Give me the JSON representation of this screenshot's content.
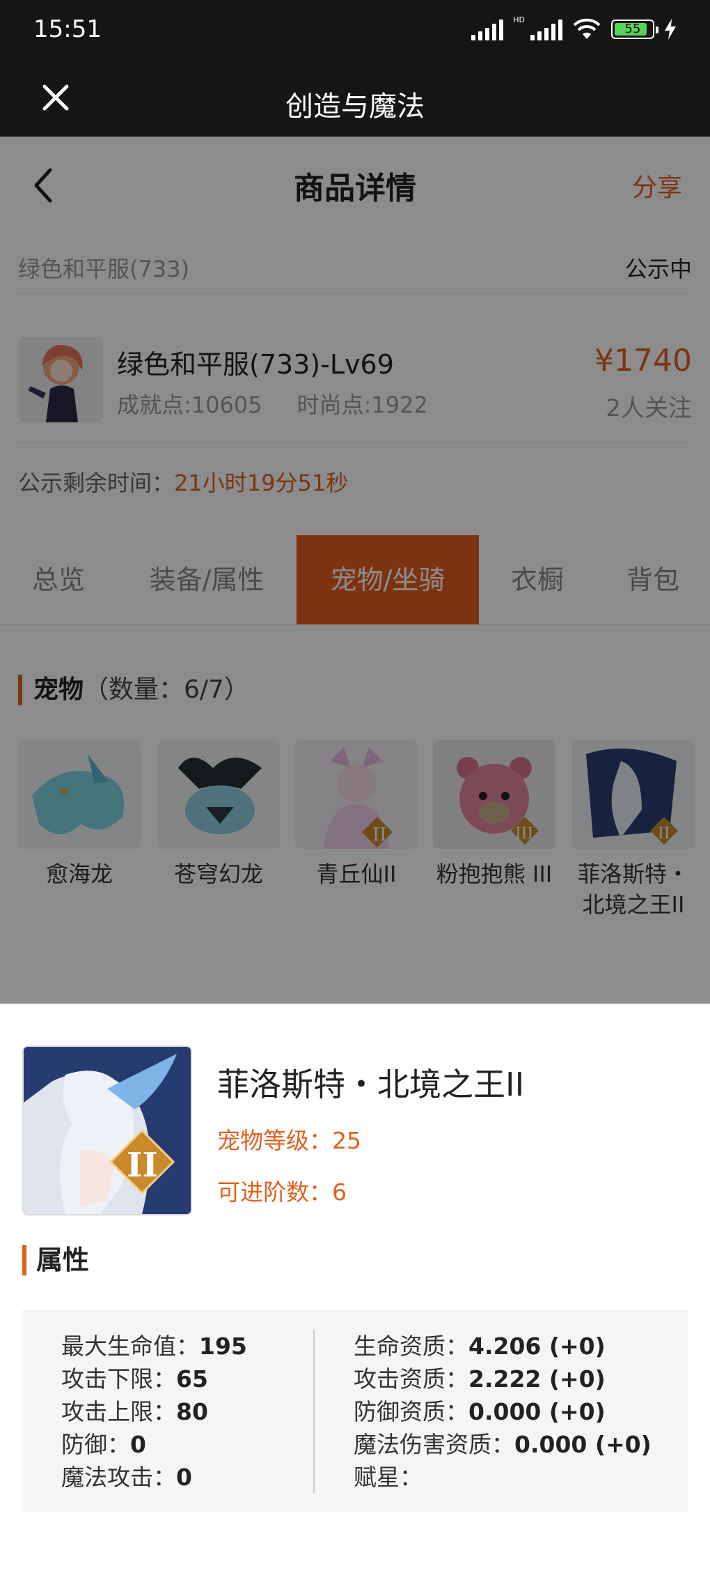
{
  "status": {
    "time": "15:51",
    "hd": "HD",
    "battery": "55"
  },
  "app": {
    "title": "创造与魔法"
  },
  "nav": {
    "title": "商品详情",
    "share": "分享"
  },
  "listing": {
    "name": "绿色和平服(733)",
    "status": "公示中"
  },
  "product": {
    "title": "绿色和平服(733)-Lv69",
    "achievement": "成就点:10605",
    "fashion": "时尚点:1922",
    "price": "¥1740",
    "followers": "2人关注"
  },
  "remain": {
    "label": "公示剩余时间：",
    "value": "21小时19分51秒"
  },
  "tabs": [
    {
      "label": "总览"
    },
    {
      "label": "装备/属性"
    },
    {
      "label": "宠物/坐骑"
    },
    {
      "label": "衣橱"
    },
    {
      "label": "背包"
    }
  ],
  "active_tab": "宠物/坐骑",
  "pets_section": {
    "title": "宠物",
    "count": "（数量：6/7）"
  },
  "pets": [
    {
      "name": "愈海龙"
    },
    {
      "name": "苍穹幻龙"
    },
    {
      "name": "青丘仙II"
    },
    {
      "name": "粉抱抱熊 III"
    },
    {
      "name": "菲洛斯特・北境之王II"
    }
  ],
  "detail": {
    "name": "菲洛斯特・北境之王II",
    "level": "宠物等级：25",
    "advance": "可进阶数：6",
    "attr_title": "属性",
    "left": [
      {
        "label": "最大生命值：",
        "value": "195"
      },
      {
        "label": "攻击下限：",
        "value": "65"
      },
      {
        "label": "攻击上限：",
        "value": "80"
      },
      {
        "label": "防御：",
        "value": "0"
      },
      {
        "label": "魔法攻击：",
        "value": "0"
      }
    ],
    "right": [
      {
        "label": "生命资质：",
        "value": "4.206 (+0)"
      },
      {
        "label": "攻击资质：",
        "value": "2.222 (+0)"
      },
      {
        "label": "防御资质：",
        "value": "0.000 (+0)"
      },
      {
        "label": "魔法伤害资质：",
        "value": "0.000 (+0)"
      },
      {
        "label": "赋星：",
        "value": ""
      }
    ]
  },
  "colors": {
    "accent": "#e0621f",
    "tab_active": "#e45b1f",
    "dark_bar": "#151515"
  }
}
